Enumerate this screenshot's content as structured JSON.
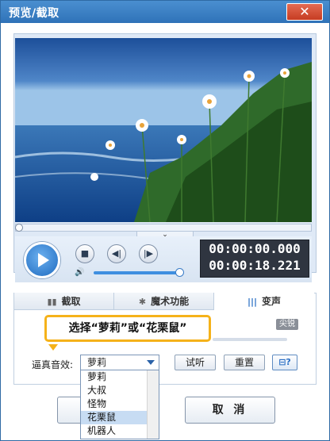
{
  "window": {
    "title": "预览/截取",
    "close_icon": "close-icon"
  },
  "player": {
    "current_time": "00:00:00.000",
    "total_time": "00:00:18.221",
    "progress": 0.0,
    "volume": 1.0
  },
  "tabs": [
    {
      "label": "截取",
      "icon": "cut-icon"
    },
    {
      "label": "魔术功能",
      "icon": "magic-icon"
    },
    {
      "label": "变声",
      "icon": "voice-icon",
      "active": true
    }
  ],
  "voice_changer": {
    "tip": "选择“萝莉”或“花栗鼠”",
    "sharp_label": "尖锐",
    "voice_label": "逼真音效:",
    "selected": "萝莉",
    "options": [
      "萝莉",
      "大叔",
      "怪物",
      "花栗鼠",
      "机器人"
    ],
    "highlighted_option": "花栗鼠",
    "audition_button": "试听",
    "reset_button": "重置",
    "help_button": "help-icon"
  },
  "footer": {
    "cancel_button": "取 消"
  },
  "colors": {
    "titlebar": "#2f72b8",
    "tip_border": "#f5b21a",
    "accent": "#2a6fc4"
  }
}
